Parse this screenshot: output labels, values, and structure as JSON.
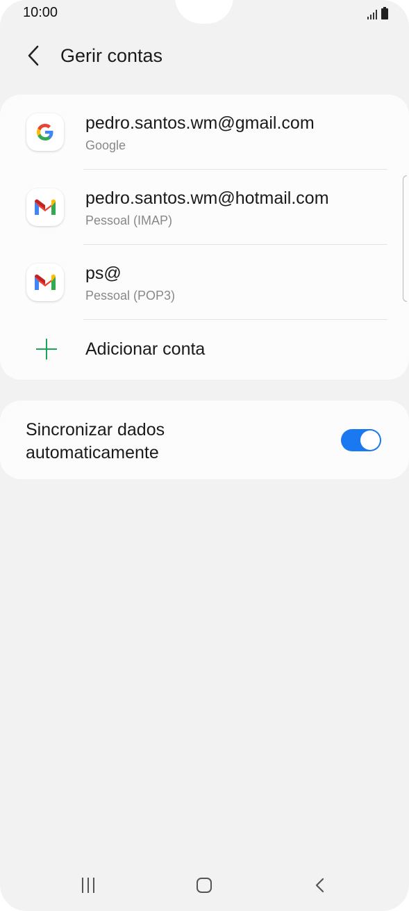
{
  "status_bar": {
    "time": "10:00"
  },
  "header": {
    "title": "Gerir contas",
    "back_icon": "chevron-left-icon"
  },
  "accounts": [
    {
      "email": "pedro.santos.wm@gmail.com",
      "type": "Google",
      "icon": "google-icon"
    },
    {
      "email": "pedro.santos.wm@hotmail.com",
      "type": "Pessoal (IMAP)",
      "icon": "gmail-icon"
    },
    {
      "email": "ps@",
      "type": "Pessoal (POP3)",
      "icon": "gmail-icon"
    }
  ],
  "add_account": {
    "label": "Adicionar conta",
    "icon": "plus-icon"
  },
  "sync": {
    "label": "Sincronizar dados automaticamente",
    "enabled": true
  },
  "colors": {
    "accent_toggle": "#1a79f0",
    "add_icon": "#1aa558",
    "background": "#f2f2f2",
    "card": "#fcfcfc"
  }
}
